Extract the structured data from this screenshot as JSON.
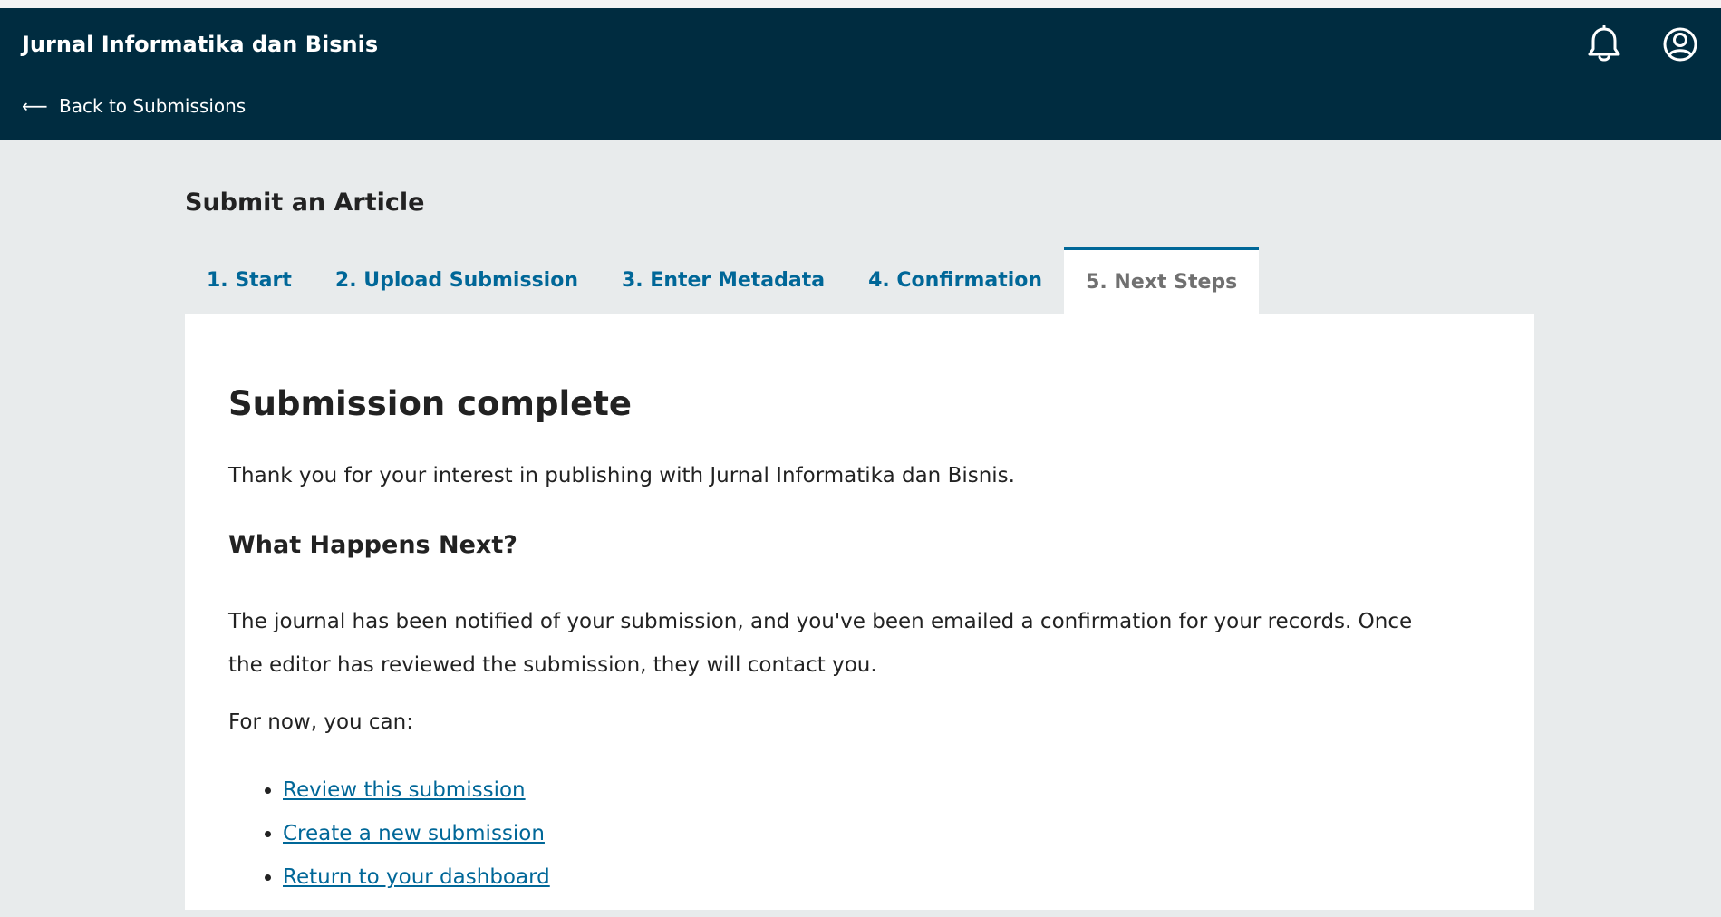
{
  "header": {
    "site_title": "Jurnal Informatika dan Bisnis",
    "back_arrow": "⟵",
    "back_label": "Back to Submissions",
    "icons": [
      "bell-icon",
      "user-profile-icon"
    ]
  },
  "page": {
    "title": "Submit an Article"
  },
  "tabs": [
    {
      "label": "1. Start"
    },
    {
      "label": "2. Upload Submission"
    },
    {
      "label": "3. Enter Metadata"
    },
    {
      "label": "4. Confirmation"
    },
    {
      "label": "5. Next Steps",
      "active": true
    }
  ],
  "content": {
    "heading": "Submission complete",
    "thanks_text": "Thank you for your interest in publishing with Jurnal Informatika dan Bisnis.",
    "subheading": "What Happens Next?",
    "notified_text": "The journal has been notified of your submission, and you've been emailed a confirmation for your records. Once the editor has reviewed the submission, they will contact you.",
    "for_now_text": "For now, you can:",
    "links": [
      {
        "label": "Review this submission"
      },
      {
        "label": "Create a new submission"
      },
      {
        "label": "Return to your dashboard"
      }
    ]
  },
  "colors": {
    "header_bg": "#002c40",
    "page_bg": "#e8ebec",
    "link": "#006798",
    "active_tab_text": "#707070",
    "text": "#222222"
  }
}
